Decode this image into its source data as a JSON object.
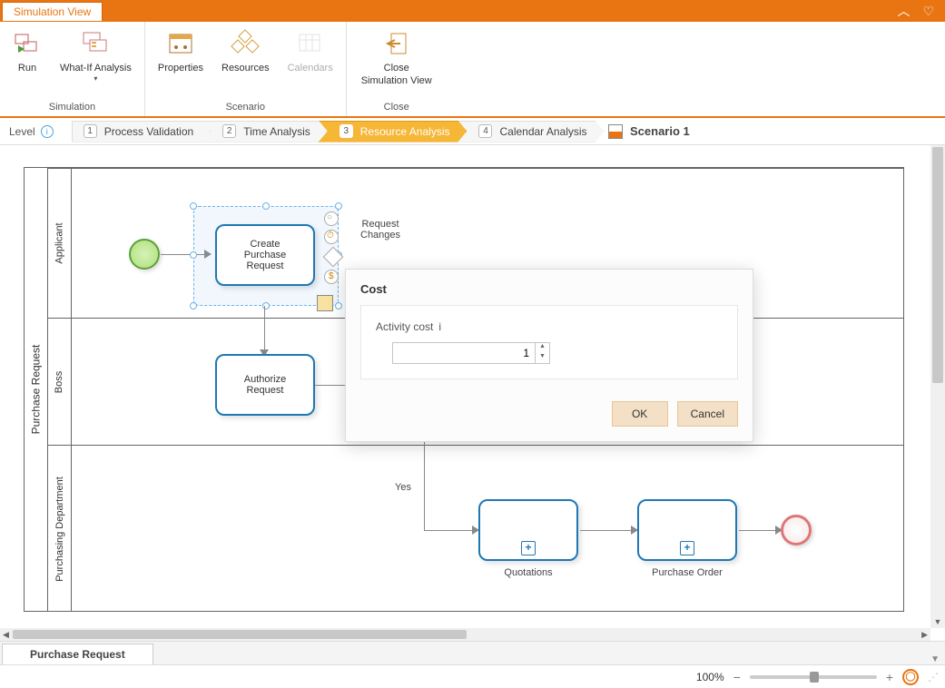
{
  "window": {
    "tab_title": "Simulation View"
  },
  "ribbon": {
    "groups": [
      {
        "label": "Simulation",
        "items": [
          {
            "label": "Run"
          },
          {
            "label": "What-If Analysis",
            "has_dropdown": true
          }
        ]
      },
      {
        "label": "Scenario",
        "items": [
          {
            "label": "Properties"
          },
          {
            "label": "Resources"
          },
          {
            "label": "Calendars",
            "disabled": true
          }
        ]
      },
      {
        "label": "Close",
        "items": [
          {
            "label": "Close\nSimulation View"
          }
        ]
      }
    ]
  },
  "level_bar": {
    "label": "Level",
    "steps": [
      {
        "num": "1",
        "label": "Process Validation"
      },
      {
        "num": "2",
        "label": "Time Analysis"
      },
      {
        "num": "3",
        "label": "Resource Analysis",
        "active": true
      },
      {
        "num": "4",
        "label": "Calendar Analysis"
      }
    ],
    "scenario_label": "Scenario 1"
  },
  "diagram": {
    "pool": "Purchase Request",
    "lanes": [
      "Applicant",
      "Boss",
      "Purchasing Department"
    ],
    "tasks": {
      "create": "Create\nPurchase\nRequest",
      "authorize": "Authorize\nRequest",
      "quotations_label": "Quotations",
      "purchase_order_label": "Purchase Order"
    },
    "flow_labels": {
      "request_changes": "Request\nChanges",
      "yes": "Yes"
    }
  },
  "dialog": {
    "title": "Cost",
    "field_label": "Activity cost",
    "value": "1",
    "ok": "OK",
    "cancel": "Cancel"
  },
  "doc_tab": "Purchase Request",
  "status": {
    "zoom": "100%"
  }
}
